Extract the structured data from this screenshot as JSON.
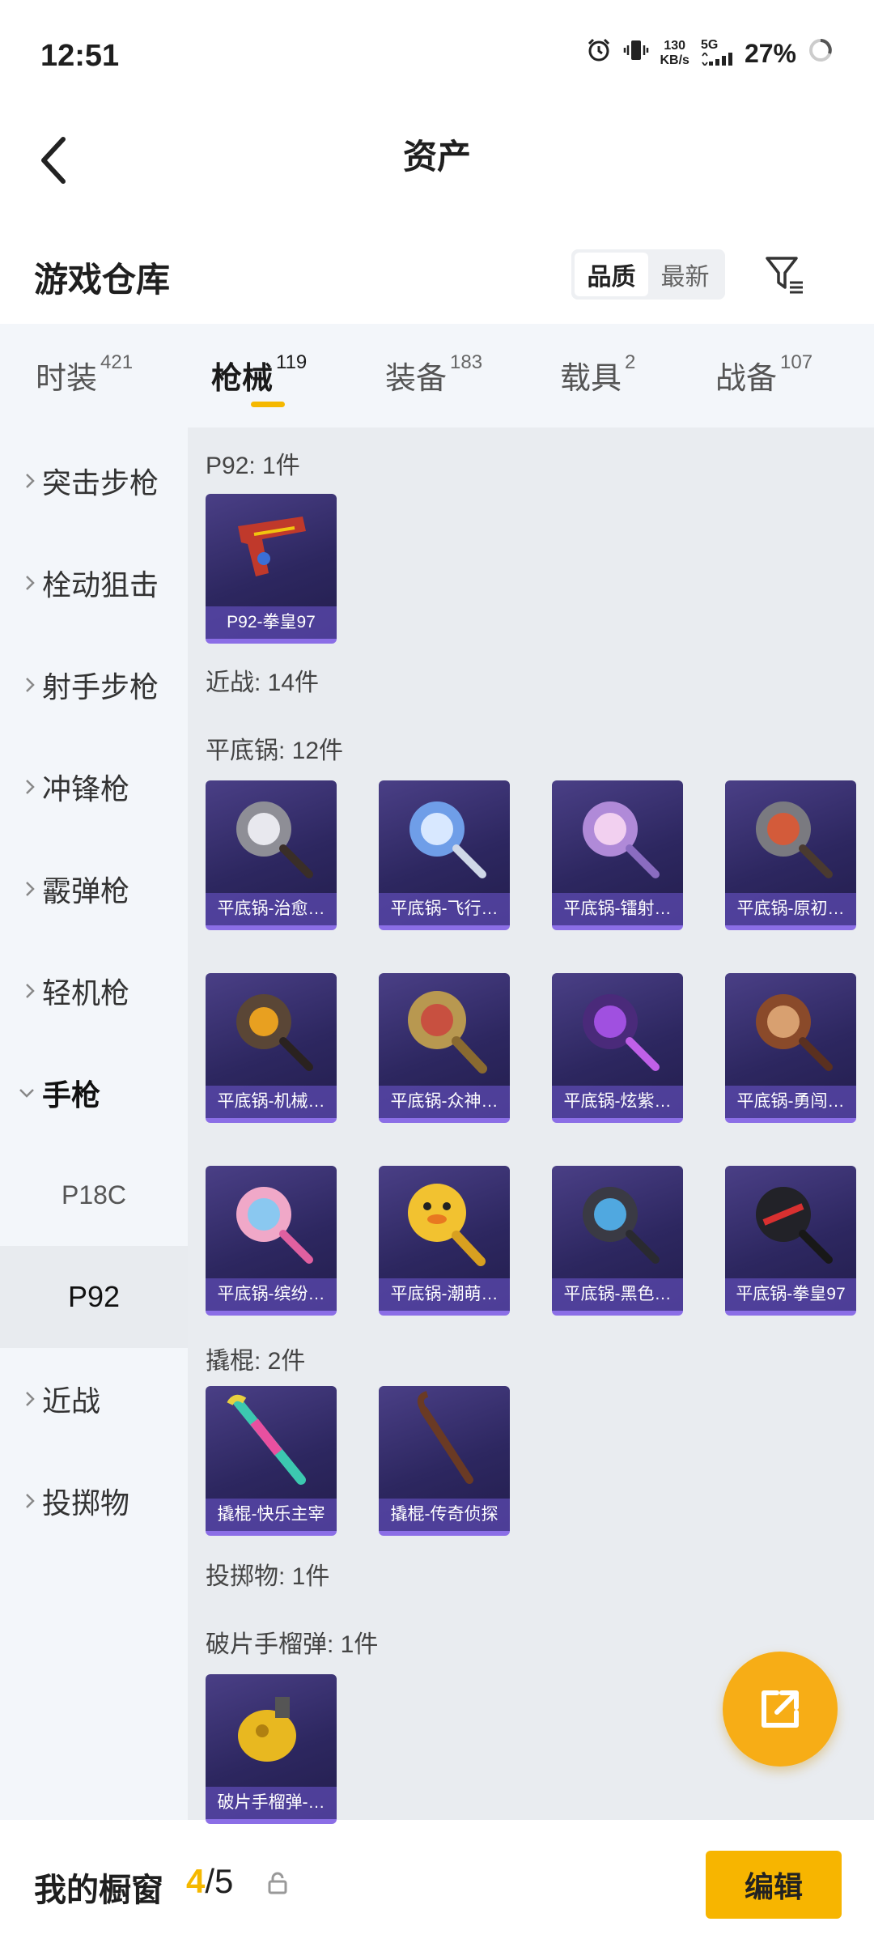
{
  "status_bar": {
    "time": "12:51",
    "net_speed": "130",
    "net_unit": "KB/s",
    "network": "5G",
    "battery": "27%"
  },
  "header": {
    "title": "资产"
  },
  "warehouse": {
    "title": "游戏仓库",
    "sort_options": [
      "品质",
      "最新"
    ],
    "active_sort": "品质"
  },
  "tabs": [
    {
      "label": "时装",
      "count": "421"
    },
    {
      "label": "枪械",
      "count": "119",
      "active": true
    },
    {
      "label": "装备",
      "count": "183"
    },
    {
      "label": "载具",
      "count": "2"
    },
    {
      "label": "战备",
      "count": "107"
    }
  ],
  "sidebar": {
    "items": [
      {
        "label": "突击步枪"
      },
      {
        "label": "栓动狙击"
      },
      {
        "label": "射手步枪"
      },
      {
        "label": "冲锋枪"
      },
      {
        "label": "霰弹枪"
      },
      {
        "label": "轻机枪"
      },
      {
        "label": "手枪",
        "expanded": true
      },
      {
        "label": "P18C",
        "sub": true
      },
      {
        "label": "P92",
        "sub": true,
        "selected": true
      },
      {
        "label": "近战"
      },
      {
        "label": "投掷物"
      }
    ]
  },
  "content": {
    "sections": {
      "p92": "P92: 1件",
      "melee": "近战: 14件",
      "pan": "平底锅: 12件",
      "crowbar": "撬棍: 2件",
      "throwable": "投掷物: 1件",
      "grenade": "破片手榴弹: 1件"
    },
    "p92_items": [
      {
        "name": "P92-拳皇97"
      }
    ],
    "pan_items": [
      {
        "name": "平底锅-治愈…"
      },
      {
        "name": "平底锅-飞行…"
      },
      {
        "name": "平底锅-镭射…"
      },
      {
        "name": "平底锅-原初…"
      },
      {
        "name": "平底锅-机械…"
      },
      {
        "name": "平底锅-众神…"
      },
      {
        "name": "平底锅-炫紫…"
      },
      {
        "name": "平底锅-勇闯…"
      },
      {
        "name": "平底锅-缤纷…"
      },
      {
        "name": "平底锅-潮萌…"
      },
      {
        "name": "平底锅-黑色…"
      },
      {
        "name": "平底锅-拳皇97"
      }
    ],
    "crowbar_items": [
      {
        "name": "撬棍-快乐主宰"
      },
      {
        "name": "撬棍-传奇侦探"
      }
    ],
    "grenade_items": [
      {
        "name": "破片手榴弹-…"
      }
    ]
  },
  "bottom_bar": {
    "title": "我的橱窗",
    "current": "4",
    "separator": "/",
    "total": "5",
    "edit_label": "编辑"
  },
  "icons": {
    "back": "chevron-left-icon",
    "filter": "filter-icon",
    "fab": "external-link-icon",
    "lock": "lock-icon"
  },
  "colors": {
    "accent": "#f7b500",
    "card_bg": "#2d2760",
    "card_border": "#8b6ee6"
  }
}
